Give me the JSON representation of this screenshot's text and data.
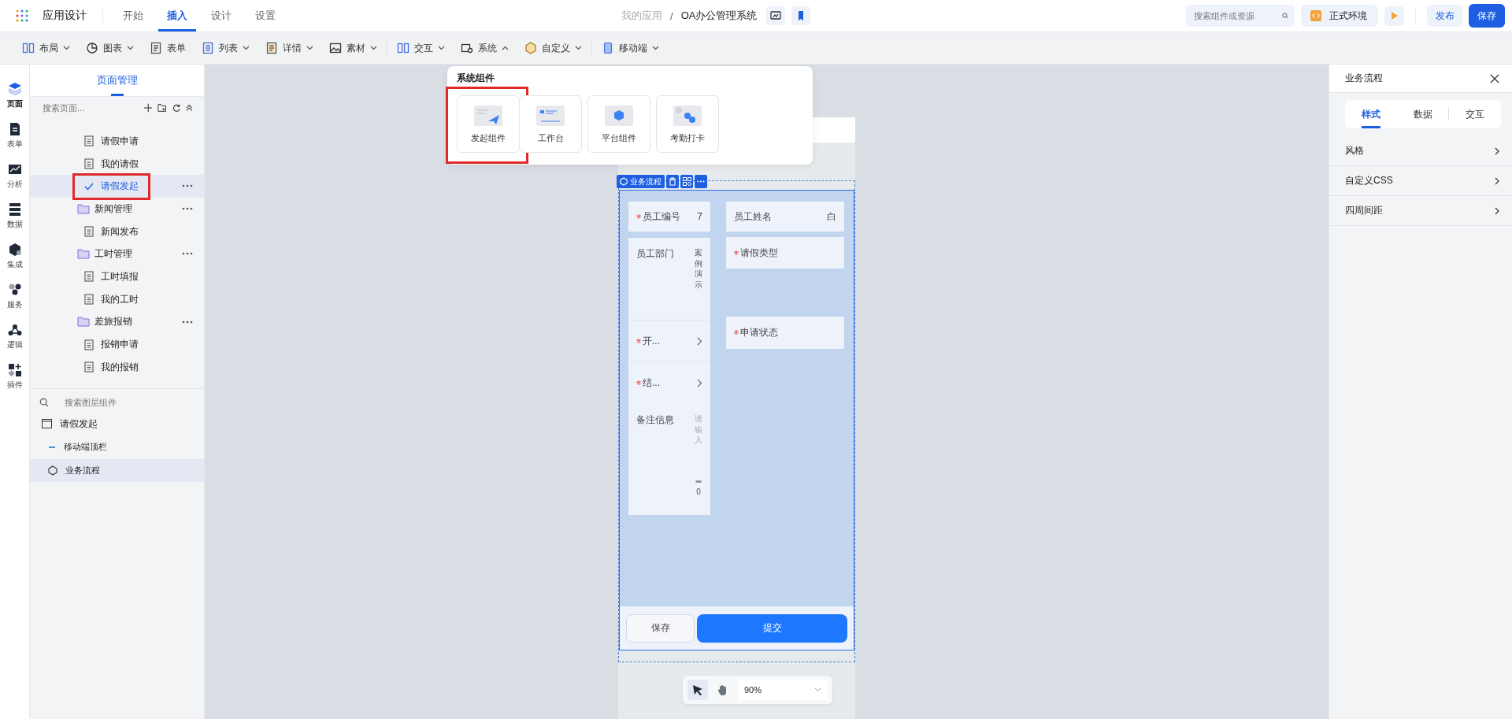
{
  "app": {
    "title": "应用设计"
  },
  "top_tabs": [
    {
      "label": "开始",
      "selected": false
    },
    {
      "label": "插入",
      "selected": true
    },
    {
      "label": "设计",
      "selected": false
    },
    {
      "label": "设置",
      "selected": false
    }
  ],
  "breadcrumb": {
    "parent": "我的应用",
    "separator": "/",
    "current": "OA办公管理系统"
  },
  "search": {
    "placeholder": "搜索组件或资源"
  },
  "environment": "正式环境",
  "actions": {
    "publish": "发布",
    "save": "保存"
  },
  "toolbar": [
    {
      "label": "布局",
      "expanded": false
    },
    {
      "label": "图表",
      "expanded": false
    },
    {
      "label": "表单"
    },
    {
      "label": "列表",
      "expanded": false
    },
    {
      "label": "详情",
      "expanded": false
    },
    {
      "label": "素材",
      "expanded": false
    },
    {
      "label": "交互",
      "expanded": false
    },
    {
      "label": "系统",
      "expanded": true
    },
    {
      "label": "自定义",
      "expanded": false
    },
    {
      "label": "移动端",
      "expanded": false
    }
  ],
  "rail": [
    {
      "label": "页面",
      "selected": true
    },
    {
      "label": "表单",
      "selected": false
    },
    {
      "label": "分析",
      "selected": false
    },
    {
      "label": "数据",
      "selected": false
    },
    {
      "label": "集成",
      "selected": false
    },
    {
      "label": "服务",
      "selected": false
    },
    {
      "label": "逻辑",
      "selected": false
    },
    {
      "label": "插件",
      "selected": false
    }
  ],
  "page_panel": {
    "title": "页面管理",
    "search_placeholder": "搜索页面...",
    "tree": [
      {
        "children": [
          {
            "label": "请假申请",
            "selected": false,
            "highlighted": false
          },
          {
            "label": "我的请假",
            "selected": false,
            "highlighted": false
          },
          {
            "label": "请假发起",
            "selected": true,
            "highlighted": true
          }
        ]
      },
      {
        "label": "新闻管理",
        "children": [
          {
            "label": "新闻发布",
            "selected": false,
            "highlighted": false
          }
        ]
      },
      {
        "label": "工时管理",
        "children": [
          {
            "label": "工时填报",
            "selected": false,
            "highlighted": false
          },
          {
            "label": "我的工时",
            "selected": false,
            "highlighted": false
          }
        ]
      },
      {
        "label": "差旅报销",
        "children": [
          {
            "label": "报销申请",
            "selected": false,
            "highlighted": false
          },
          {
            "label": "我的报销",
            "selected": false,
            "highlighted": false
          }
        ]
      }
    ]
  },
  "layers": {
    "search_placeholder": "搜索图层组件",
    "items": [
      {
        "label": "请假发起",
        "kind": "page",
        "selected": false,
        "children": [
          {
            "label": "移动端顶栏",
            "kind": "header",
            "selected": false
          },
          {
            "label": "业务流程",
            "kind": "flow",
            "selected": true
          }
        ]
      }
    ]
  },
  "dropdown": {
    "title": "系统组件",
    "items": [
      {
        "label": "发起组件",
        "highlighted": true
      },
      {
        "label": "工作台",
        "highlighted": false
      },
      {
        "label": "平台组件",
        "highlighted": false
      },
      {
        "label": "考勤打卡",
        "highlighted": false
      }
    ]
  },
  "canvas": {
    "component_tag": "业务流程",
    "left_fields": [
      {
        "kind": "text",
        "label": "员工编号",
        "required": true,
        "value": "7"
      },
      {
        "kind": "vertical",
        "label": "员工部门",
        "required": false,
        "value": "案例演示"
      },
      {
        "kind": "picker",
        "label": "开...",
        "required": true
      },
      {
        "kind": "picker",
        "label": "结...",
        "required": true
      },
      {
        "kind": "textarea",
        "label": "备注信息",
        "required": false,
        "placeholder": "请输入",
        "counter": "0"
      }
    ],
    "right_fields": [
      {
        "label": "员工姓名",
        "required": false,
        "value": "白"
      },
      {
        "label": "请假类型",
        "required": true
      },
      {
        "label": "申请状态",
        "required": true
      }
    ],
    "buttons": [
      {
        "label": "保存",
        "kind": "secondary"
      },
      {
        "label": "提交",
        "kind": "primary"
      }
    ],
    "zoom": "90%"
  },
  "right_panel": {
    "title": "业务流程",
    "tabs": [
      {
        "label": "样式",
        "selected": true
      },
      {
        "label": "数据",
        "selected": false
      },
      {
        "label": "交互",
        "selected": false
      }
    ],
    "sections": [
      "风格",
      "自定义CSS",
      "四周间距"
    ]
  }
}
